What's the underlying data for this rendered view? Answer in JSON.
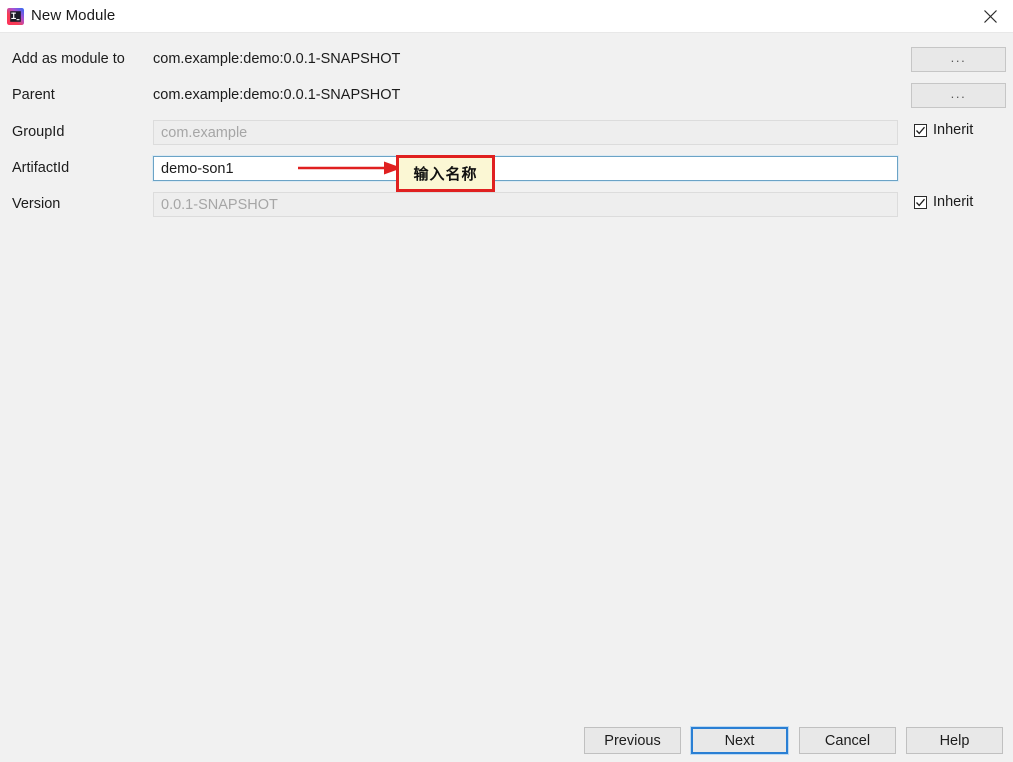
{
  "window": {
    "title": "New Module",
    "app_icon": "intellij-idea-icon",
    "close_icon": "close-icon"
  },
  "form": {
    "rows": [
      {
        "label": "Add as module to",
        "type": "static",
        "value": "com.example:demo:0.0.1-SNAPSHOT",
        "trailing": "browse",
        "browse_label": "..."
      },
      {
        "label": "Parent",
        "type": "static",
        "value": "com.example:demo:0.0.1-SNAPSHOT",
        "trailing": "browse",
        "browse_label": "..."
      },
      {
        "label": "GroupId",
        "type": "field",
        "value": "com.example",
        "state": "disabled",
        "trailing": "inherit",
        "inherit_label": "Inherit",
        "inherit_checked": true
      },
      {
        "label": "ArtifactId",
        "type": "field",
        "value": "demo-son1",
        "state": "focused",
        "trailing": "none"
      },
      {
        "label": "Version",
        "type": "field",
        "value": "0.0.1-SNAPSHOT",
        "state": "disabled",
        "trailing": "inherit",
        "inherit_label": "Inherit",
        "inherit_checked": true
      }
    ]
  },
  "annotation": {
    "text": "输入名称",
    "arrow_icon": "red-arrow-right-icon",
    "box_border_color": "#e02020",
    "box_fill_color": "#fbf7d4"
  },
  "footer": {
    "buttons": [
      {
        "label": "Previous",
        "focused": false
      },
      {
        "label": "Next",
        "focused": true
      },
      {
        "label": "Cancel",
        "focused": false
      },
      {
        "label": "Help",
        "focused": false
      }
    ]
  },
  "colors": {
    "background": "#f1f1f1",
    "titlebar": "#ffffff",
    "focus_blue": "#2a7fd4",
    "field_focus_border": "#6ba3c6"
  }
}
